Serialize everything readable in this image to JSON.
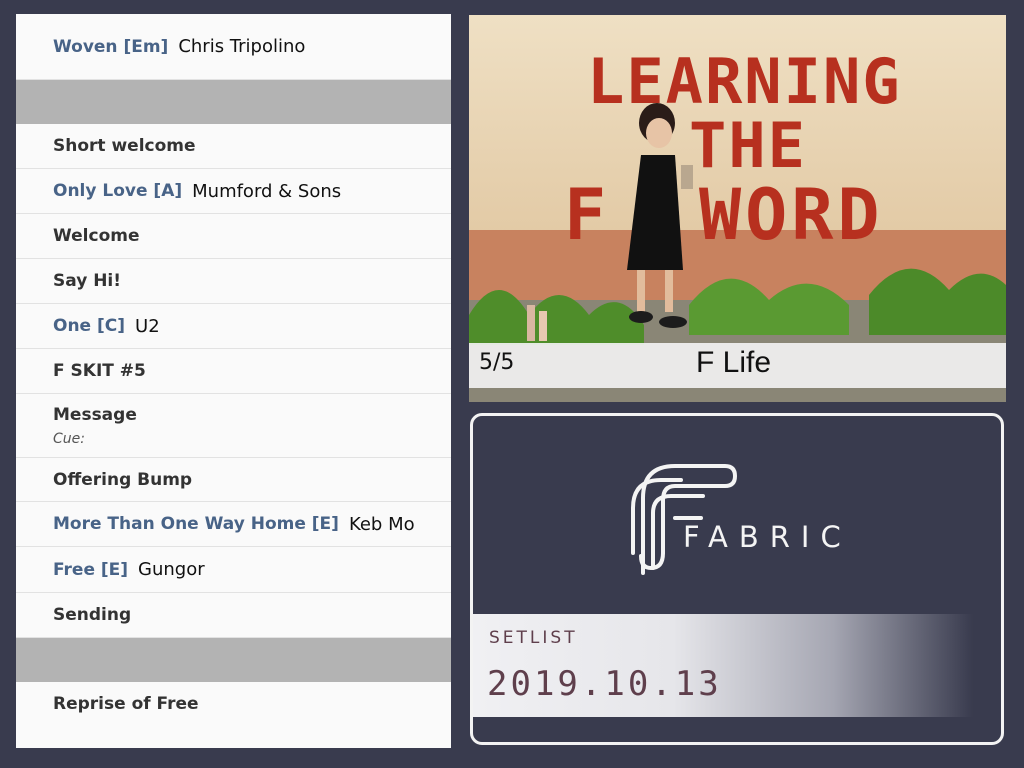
{
  "setlist": {
    "rows": [
      {
        "type": "song",
        "title": "Woven [Em]",
        "artist": "Chris Tripolino"
      },
      {
        "type": "divider"
      },
      {
        "type": "item",
        "title": "Short welcome"
      },
      {
        "type": "song",
        "title": "Only Love [A]",
        "artist": "Mumford & Sons"
      },
      {
        "type": "item",
        "title": "Welcome"
      },
      {
        "type": "item",
        "title": "Say Hi!"
      },
      {
        "type": "song",
        "title": "One [C]",
        "artist": "U2"
      },
      {
        "type": "item",
        "title": "F SKIT #5"
      },
      {
        "type": "message",
        "title": "Message",
        "cue": "Cue:"
      },
      {
        "type": "item",
        "title": "Offering Bump"
      },
      {
        "type": "song",
        "title": "More Than One Way Home [E]",
        "artist": "Keb Mo"
      },
      {
        "type": "song",
        "title": "Free [E]",
        "artist": "Gungor"
      },
      {
        "type": "item",
        "title": "Sending"
      },
      {
        "type": "divider"
      },
      {
        "type": "item",
        "title": "Reprise of Free"
      }
    ]
  },
  "artwork": {
    "wall_text": [
      "LEARNING",
      "THE",
      "F",
      "WORD"
    ],
    "slide_counter": "5/5",
    "slide_title": "F Life"
  },
  "brand": {
    "logo_text": "FABRIC",
    "band_label": "SETLIST",
    "date": "2019.10.13"
  },
  "colors": {
    "background": "#393b4e",
    "song_title": "#486387",
    "divider": "#b3b3b3",
    "stencil_red": "#b7301f",
    "band_text": "#5f3f4c"
  }
}
